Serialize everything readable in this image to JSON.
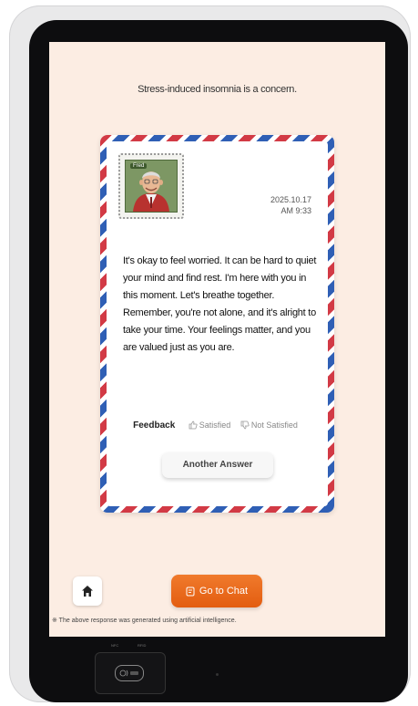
{
  "header": {
    "headline": "Stress-induced insomnia is a concern."
  },
  "letter": {
    "stamp_name": "Fred",
    "date": "2025.10.17",
    "time": "AM 9:33",
    "message": "It's okay to feel worried. It can be hard to quiet your mind and find rest. I'm here with you in this moment. Let's breathe together. Remember, you're not alone, and it's alright to take your time. Your feelings matter, and you are valued just as you are."
  },
  "feedback": {
    "label": "Feedback",
    "satisfied": "Satisfied",
    "not_satisfied": "Not Satisfied"
  },
  "buttons": {
    "another_answer": "Another Answer",
    "go_to_chat": "Go to Chat"
  },
  "footer": {
    "disclaimer": "※ The above response was generated using artificial intelligence."
  },
  "hardware": {
    "nfc_label": "NFC",
    "rfid_label": "RFID"
  },
  "colors": {
    "screen_bg": "#fcede3",
    "accent_orange": "#e8671a",
    "airmail_red": "#d23a45",
    "airmail_blue": "#2f5fb5"
  },
  "icons": [
    "home-icon",
    "chat-icon",
    "thumbs-up-icon",
    "thumbs-down-icon",
    "nfc-icon"
  ]
}
